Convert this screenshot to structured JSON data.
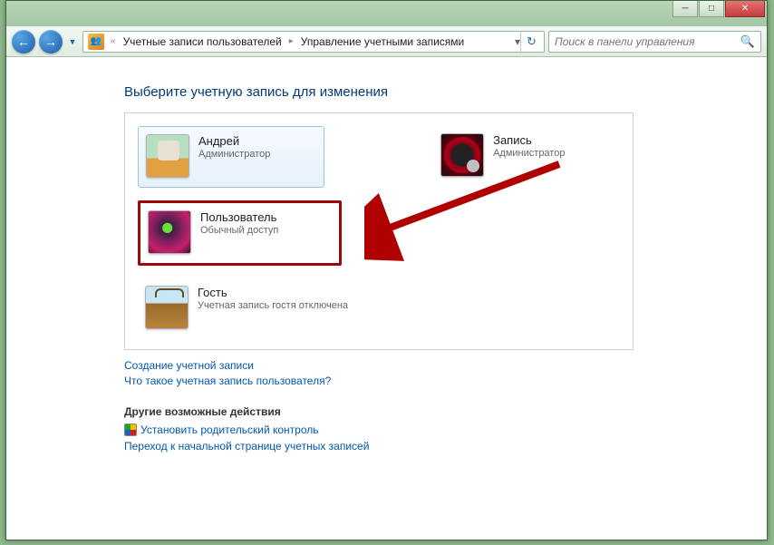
{
  "titlebar": {
    "minimize": "─",
    "maximize": "□",
    "close": "✕"
  },
  "nav": {
    "back": "←",
    "forward": "→",
    "history_dropdown": "▼"
  },
  "breadcrumb": {
    "prefix": "«",
    "seg1": "Учетные записи пользователей",
    "seg2": "Управление учетными записями",
    "chevron": "▸",
    "end_dropdown": "▾"
  },
  "refresh": "↻",
  "search": {
    "placeholder": "Поиск в панели управления",
    "mag": "🔍"
  },
  "heading": "Выберите учетную запись для изменения",
  "accounts": {
    "andrey": {
      "name": "Андрей",
      "role": "Администратор"
    },
    "zapis": {
      "name": "Запись",
      "role": "Администратор"
    },
    "polzovatel": {
      "name": "Пользователь",
      "role": "Обычный доступ"
    },
    "guest": {
      "name": "Гость",
      "role": "Учетная запись гостя отключена"
    }
  },
  "links": {
    "create": "Создание учетной записи",
    "whatis": "Что такое учетная запись пользователя?"
  },
  "other": {
    "heading": "Другие возможные действия",
    "parental": "Установить родительский контроль",
    "gotostart": "Переход к начальной странице учетных записей"
  }
}
